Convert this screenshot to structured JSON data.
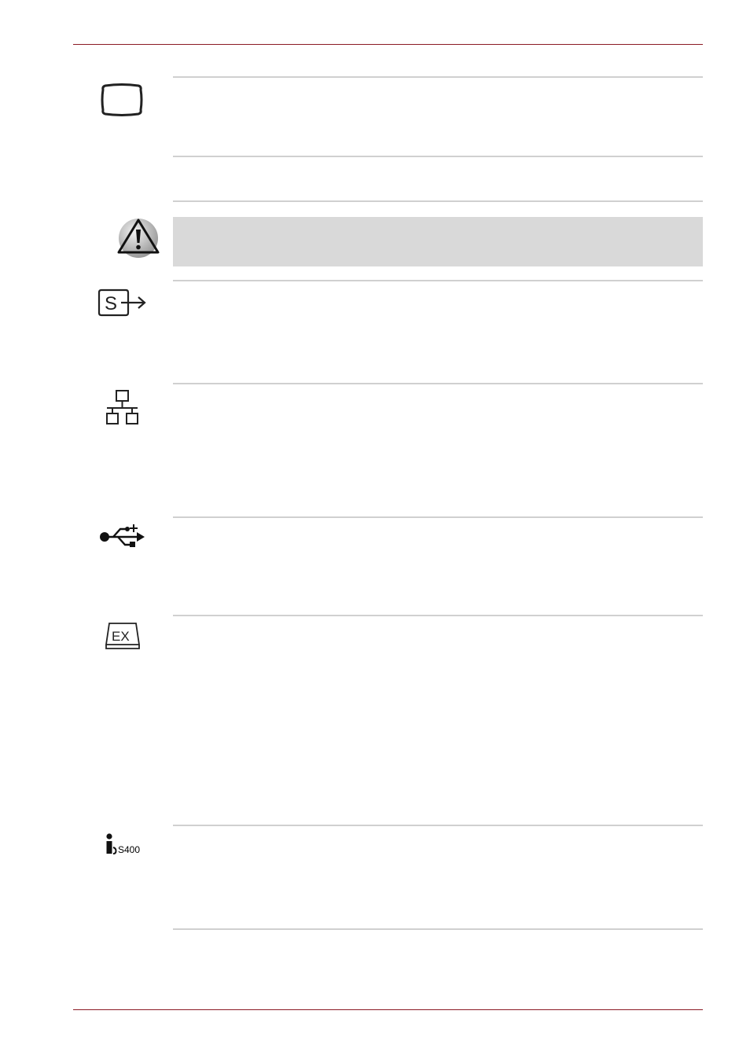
{
  "icons": {
    "monitor": "monitor-icon",
    "caution": "caution-triangle-icon",
    "svideo": "s-video-out-icon",
    "lan": "lan-network-icon",
    "usb": "usb-icon",
    "expresscard": "expresscard-icon",
    "ilink": "ilink-s400-icon"
  },
  "ilink_label": "S400",
  "colors": {
    "header_rule": "#8b1a24",
    "section_rule": "#d0d0d0",
    "caution_background": "#d9d9d9"
  }
}
